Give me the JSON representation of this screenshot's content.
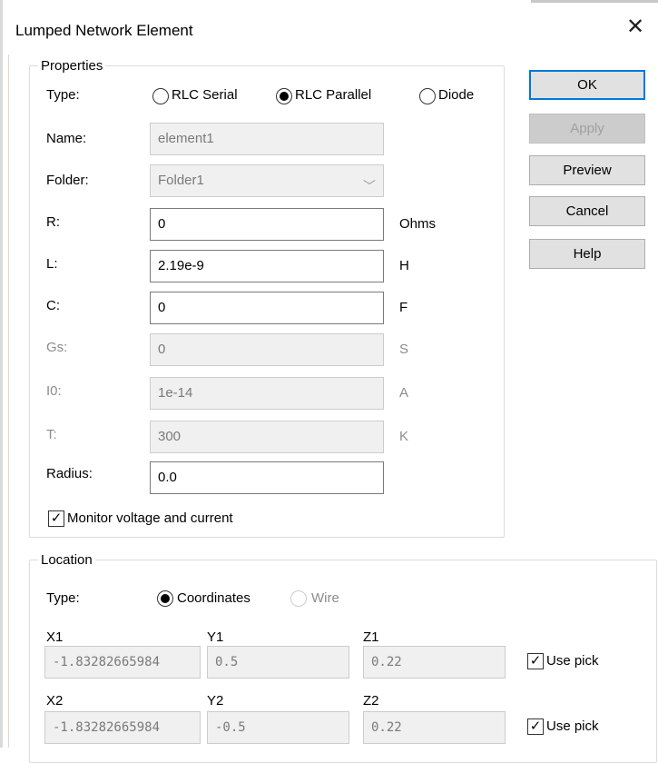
{
  "dialog": {
    "title": "Lumped Network Element",
    "close_glyph": "✕"
  },
  "buttons": {
    "ok": "OK",
    "apply": "Apply",
    "preview": "Preview",
    "cancel": "Cancel",
    "help": "Help"
  },
  "properties": {
    "legend": "Properties",
    "type_label": "Type:",
    "type_options": [
      "RLC Serial",
      "RLC Parallel",
      "Diode"
    ],
    "type_selected": "RLC Parallel",
    "name_label": "Name:",
    "name_value": "element1",
    "folder_label": "Folder:",
    "folder_value": "Folder1",
    "folder_chevron": "﹀",
    "r_label": "R:",
    "r_value": "0",
    "r_unit": "Ohms",
    "l_label": "L:",
    "l_value": "2.19e-9",
    "l_unit": "H",
    "c_label": "C:",
    "c_value": "0",
    "c_unit": "F",
    "gs_label": "Gs:",
    "gs_value": "0",
    "gs_unit": "S",
    "i0_label": "I0:",
    "i0_value": "1e-14",
    "i0_unit": "A",
    "t_label": "T:",
    "t_value": "300",
    "t_unit": "K",
    "radius_label": "Radius:",
    "radius_value": "0.0",
    "monitor_label": "Monitor voltage and current",
    "monitor_checked": true,
    "check_glyph": "✓"
  },
  "location": {
    "legend": "Location",
    "type_label": "Type:",
    "opt_coordinates": "Coordinates",
    "opt_wire": "Wire",
    "selected": "Coordinates",
    "x1_label": "X1",
    "y1_label": "Y1",
    "z1_label": "Z1",
    "x1_value": "-1.83282665984",
    "y1_value": "0.5",
    "z1_value": "0.22",
    "x2_label": "X2",
    "y2_label": "Y2",
    "z2_label": "Z2",
    "x2_value": "-1.83282665984",
    "y2_value": "-0.5",
    "z2_value": "0.22",
    "use_pick_label": "Use pick",
    "use_pick_1_checked": true,
    "use_pick_2_checked": true
  },
  "colors": {
    "primary_border": "#0078d7",
    "button_face": "#e1e1e1",
    "disabled_text": "#8c8c8c"
  }
}
